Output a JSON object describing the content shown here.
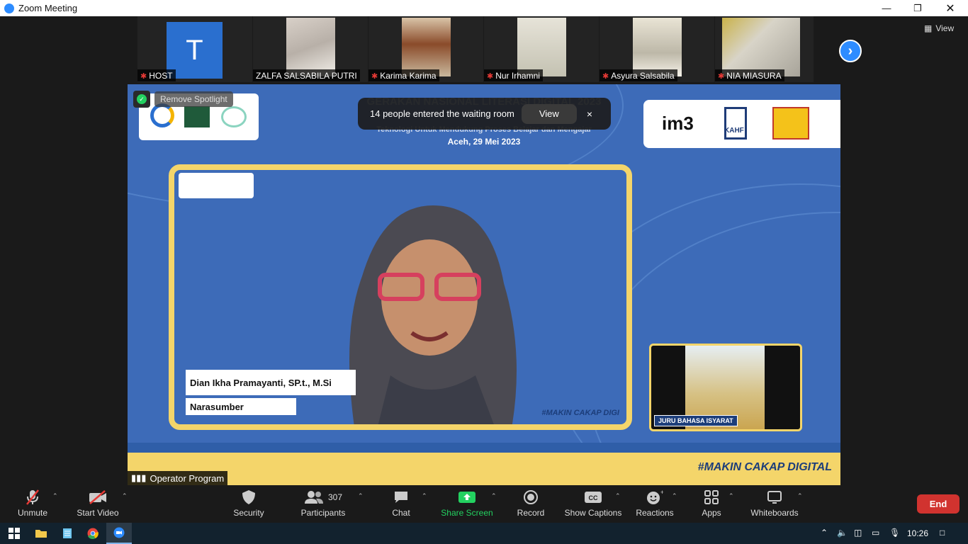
{
  "window": {
    "title": "Zoom Meeting"
  },
  "gallery": {
    "participants": [
      {
        "name": "HOST",
        "initial": "T"
      },
      {
        "name": "ZALFA SALSABILA PUTRI"
      },
      {
        "name": "Karima Karima"
      },
      {
        "name": "Nur Irhamni"
      },
      {
        "name": "Asyura Salsabila"
      },
      {
        "name": "NIA MIASURA"
      }
    ],
    "view_label": "View"
  },
  "spotlight": {
    "remove_label": "Remove Spotlight"
  },
  "notification": {
    "text": "14 people entered the waiting room",
    "view_label": "View",
    "close_label": "×"
  },
  "stream": {
    "event_title": "GERAKAN NASIONAL LITERASI DIGITAL 2023",
    "event_subtitle": "Teknologi Untuk Mendukung Proses Belajar dan Mengajar",
    "event_date": "Aceh, 29 Mei 2023",
    "sponsor_im3": "im3",
    "sponsor_kahf": "KAHF",
    "speaker_name": "Dian Ikha Pramayanti, SP.t., M.Si",
    "speaker_role": "Narasumber",
    "sign_label": "JURU BAHASA ISYARAT",
    "hashtag": "#MAKIN CAKAP DIGITAL",
    "hashtag_small": "#MAKIN CAKAP DIGI"
  },
  "active_speaker": {
    "name": "Operator Program"
  },
  "toolbar": {
    "unmute": "Unmute",
    "start_video": "Start Video",
    "security": "Security",
    "participants": "Participants",
    "participants_count": "307",
    "chat": "Chat",
    "share_screen": "Share Screen",
    "record": "Record",
    "show_captions": "Show Captions",
    "reactions": "Reactions",
    "apps": "Apps",
    "whiteboards": "Whiteboards",
    "end": "End"
  },
  "taskbar": {
    "time": "10:26"
  },
  "colors": {
    "accent": "#2d8cff",
    "end": "#d1332f",
    "share": "#23d160",
    "brand_blue": "#3d6bb8",
    "brand_yellow": "#f4d56a"
  }
}
